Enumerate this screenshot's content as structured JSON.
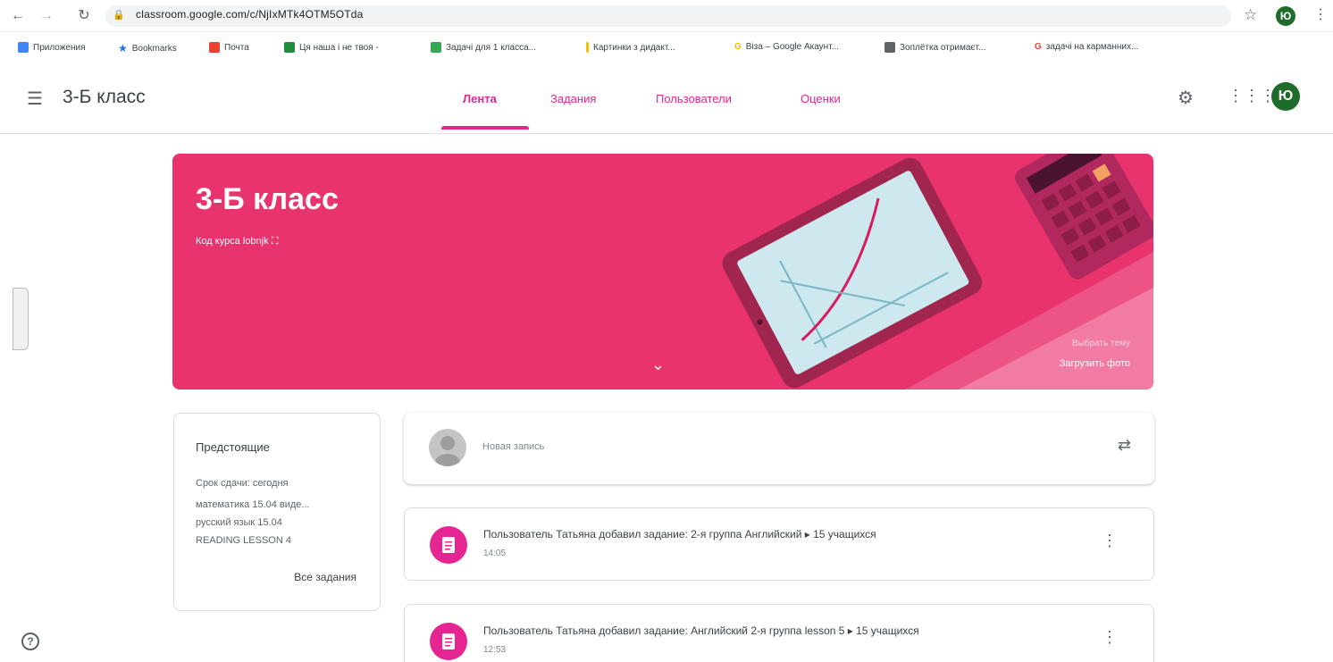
{
  "browser": {
    "url": "classroom.google.com/c/NjIxMTk4OTM5OTda",
    "profile_initial": "Ю",
    "bookmarks": [
      {
        "label": "Приложения",
        "color": "#4285f4"
      },
      {
        "label": "Bookmarks",
        "color": "#1a73e8"
      },
      {
        "label": "Почта",
        "color": "#ea4335"
      },
      {
        "label": "Ця наша і не твоя -",
        "color": "#1e8e3e"
      },
      {
        "label": "Задачі для 1 класса...",
        "color": "#34a853"
      },
      {
        "label": "Картинки з дидакт...",
        "color": "#fbbc04"
      },
      {
        "label": "Віза – Google Акаунт...",
        "color": "#fbbc04"
      },
      {
        "label": "Зоплётка отримаєт...",
        "color": "#5f6368"
      },
      {
        "label": "задачі на карманних...",
        "color": "#ea4335"
      }
    ]
  },
  "header": {
    "class_name": "3-Б класс",
    "tabs": [
      "Лента",
      "Задания",
      "Пользователи",
      "Оценки"
    ],
    "active_tab": "Лента",
    "avatar_initial": "Ю"
  },
  "banner": {
    "title": "3-Б класс",
    "code_label": "Код курса",
    "code_value": "lobnjk",
    "select_theme": "Выбрать тему",
    "upload_photo": "Загрузить фото",
    "color": "#e8336d"
  },
  "upcoming": {
    "title": "Предстоящие",
    "lines": [
      "Срок сдачи: сегодня",
      "математика 15.04 виде...",
      "русский язык 15.04",
      "READING LESSON 4"
    ],
    "all_tasks": "Все задания"
  },
  "stream": {
    "new_post_placeholder": "Новая запись",
    "items": [
      {
        "text": "Пользователь Татьяна добавил задание: 2-я группа Английский  ▸  15 учащихся",
        "time": "14:05"
      },
      {
        "text": "Пользователь Татьяна добавил задание: Английский 2-я группа lesson 5  ▸  15 учащихся",
        "time": "12:53"
      }
    ]
  }
}
